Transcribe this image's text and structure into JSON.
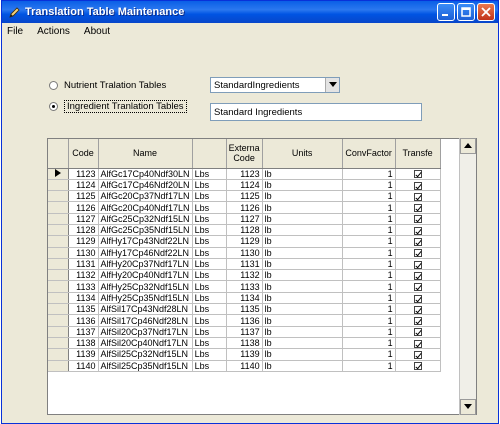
{
  "window": {
    "title": "Translation Table Maintenance",
    "title_icon": "pen-icon"
  },
  "menu": [
    {
      "label": "File"
    },
    {
      "label": "Actions"
    },
    {
      "label": "About"
    }
  ],
  "options": {
    "nutrient_label": "Nutrient Tralation Tables",
    "ingredient_label": "Ingredient Tranlation Tables",
    "selected": "ingredient"
  },
  "table_select": {
    "value": "StandardIngredients"
  },
  "table_name": {
    "value": "Standard Ingredients"
  },
  "grid": {
    "columns": [
      "Code",
      "Name",
      "",
      "Externa\nCode",
      "Units",
      "ConvFactor",
      "Transfe"
    ],
    "rows": [
      {
        "code": "1123",
        "name": "AlfGc17Cp40Ndf30LN",
        "name2": "Lbs",
        "ext": "1123",
        "units": "lb",
        "conv": "1",
        "tr": true
      },
      {
        "code": "1124",
        "name": "AlfGc17Cp46Ndf20LN",
        "name2": "Lbs",
        "ext": "1124",
        "units": "lb",
        "conv": "1",
        "tr": true
      },
      {
        "code": "1125",
        "name": "AlfGc20Cp37Ndf17LN",
        "name2": "Lbs",
        "ext": "1125",
        "units": "lb",
        "conv": "1",
        "tr": true
      },
      {
        "code": "1126",
        "name": "AlfGc20Cp40Ndf17LN",
        "name2": "Lbs",
        "ext": "1126",
        "units": "lb",
        "conv": "1",
        "tr": true
      },
      {
        "code": "1127",
        "name": "AlfGc25Cp32Ndf15LN",
        "name2": "Lbs",
        "ext": "1127",
        "units": "lb",
        "conv": "1",
        "tr": true
      },
      {
        "code": "1128",
        "name": "AlfGc25Cp35Ndf15LN",
        "name2": "Lbs",
        "ext": "1128",
        "units": "lb",
        "conv": "1",
        "tr": true
      },
      {
        "code": "1129",
        "name": "AlfHy17Cp43Ndf22LN",
        "name2": "Lbs",
        "ext": "1129",
        "units": "lb",
        "conv": "1",
        "tr": true
      },
      {
        "code": "1130",
        "name": "AlfHy17Cp46Ndf22LN",
        "name2": "Lbs",
        "ext": "1130",
        "units": "lb",
        "conv": "1",
        "tr": true
      },
      {
        "code": "1131",
        "name": "AlfHy20Cp37Ndf17LN",
        "name2": "Lbs",
        "ext": "1131",
        "units": "lb",
        "conv": "1",
        "tr": true
      },
      {
        "code": "1132",
        "name": "AlfHy20Cp40Ndf17LN",
        "name2": "Lbs",
        "ext": "1132",
        "units": "lb",
        "conv": "1",
        "tr": true
      },
      {
        "code": "1133",
        "name": "AlfHy25Cp32Ndf15LN",
        "name2": "Lbs",
        "ext": "1133",
        "units": "lb",
        "conv": "1",
        "tr": true
      },
      {
        "code": "1134",
        "name": "AlfHy25Cp35Ndf15LN",
        "name2": "Lbs",
        "ext": "1134",
        "units": "lb",
        "conv": "1",
        "tr": true
      },
      {
        "code": "1135",
        "name": "AlfSil17Cp43Ndf28LN",
        "name2": "Lbs",
        "ext": "1135",
        "units": "lb",
        "conv": "1",
        "tr": true
      },
      {
        "code": "1136",
        "name": "AlfSil17Cp46Ndf28LN",
        "name2": "Lbs",
        "ext": "1136",
        "units": "lb",
        "conv": "1",
        "tr": true
      },
      {
        "code": "1137",
        "name": "AlfSil20Cp37Ndf17LN",
        "name2": "Lbs",
        "ext": "1137",
        "units": "lb",
        "conv": "1",
        "tr": true
      },
      {
        "code": "1138",
        "name": "AlfSil20Cp40Ndf17LN",
        "name2": "Lbs",
        "ext": "1138",
        "units": "lb",
        "conv": "1",
        "tr": true
      },
      {
        "code": "1139",
        "name": "AlfSil25Cp32Ndf15LN",
        "name2": "Lbs",
        "ext": "1139",
        "units": "lb",
        "conv": "1",
        "tr": true
      },
      {
        "code": "1140",
        "name": "AlfSil25Cp35Ndf15LN",
        "name2": "Lbs",
        "ext": "1140",
        "units": "lb",
        "conv": "1",
        "tr": true
      }
    ]
  },
  "colors": {
    "titlebar": "#0054e3",
    "window_bg": "#ece9d8"
  }
}
